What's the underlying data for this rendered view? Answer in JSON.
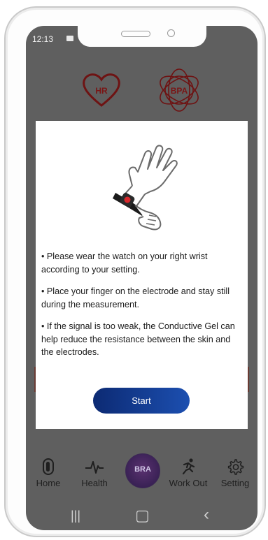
{
  "status": {
    "time": "12:13",
    "image_icon": "image-icon"
  },
  "background": {
    "hr_label": "HR",
    "bpa_label": "BPA"
  },
  "dialog": {
    "illustration": "wrist-watch-finger-icon",
    "tips": [
      "• Please wear the watch on your right wrist according to your setting.",
      "• Place your finger on the electrode and stay still during the measurement.",
      "• If the signal is too weak, the Conductive Gel can help reduce the resistance between the skin and the electrodes."
    ],
    "start_label": "Start"
  },
  "nav": {
    "items": [
      {
        "label": "Home",
        "icon": "band-icon"
      },
      {
        "label": "Health",
        "icon": "heartbeat-icon"
      },
      {
        "label": "BRA",
        "icon": "bra-logo"
      },
      {
        "label": "Work Out",
        "icon": "running-icon"
      },
      {
        "label": "Setting",
        "icon": "gear-icon"
      }
    ]
  },
  "system_keys": {
    "recent": "|||",
    "home": "▢",
    "back": "‹"
  },
  "colors": {
    "accent": "#1c4fb0",
    "overlay": "#5f5f5f",
    "logo_red": "#7a1515"
  }
}
